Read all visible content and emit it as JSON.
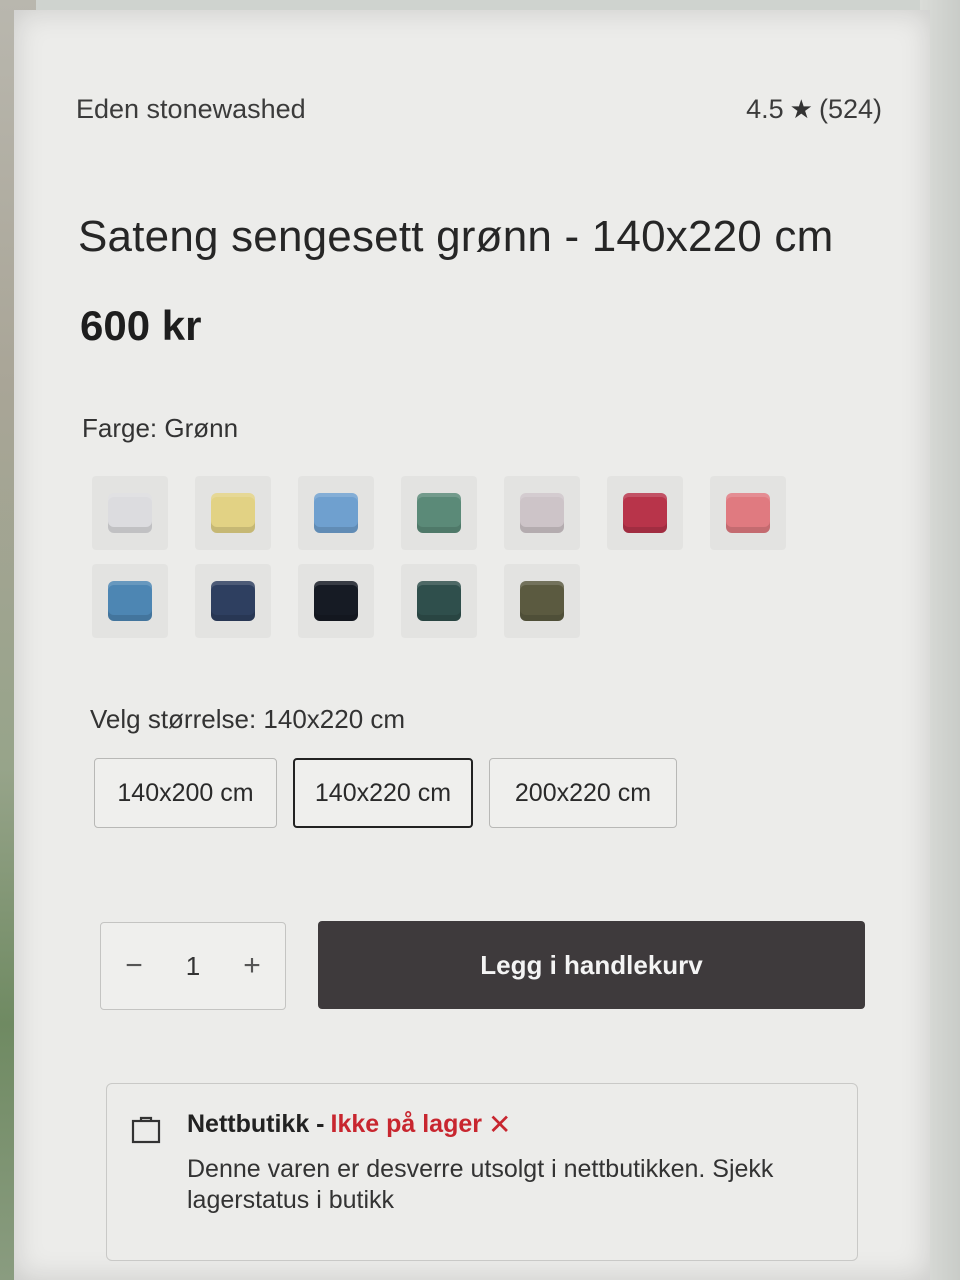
{
  "product": {
    "brand": "Eden stonewashed",
    "rating": "4.5",
    "rating_star": "★",
    "review_count": "(524)",
    "title": "Sateng sengesett grønn - 140x220 cm",
    "price": "600 kr"
  },
  "color": {
    "label": "Farge: Grønn",
    "swatches": [
      {
        "name": "white",
        "hex": "#dcdcdf"
      },
      {
        "name": "yellow",
        "hex": "#e2d284"
      },
      {
        "name": "light-blue",
        "hex": "#6fa0cf"
      },
      {
        "name": "green",
        "hex": "#5b8a78"
      },
      {
        "name": "light-grey",
        "hex": "#cdc4c8"
      },
      {
        "name": "red",
        "hex": "#b8344a"
      },
      {
        "name": "pink",
        "hex": "#e07a80"
      },
      {
        "name": "blue",
        "hex": "#4d86b3"
      },
      {
        "name": "navy",
        "hex": "#2e3f60"
      },
      {
        "name": "black",
        "hex": "#161b24"
      },
      {
        "name": "dark-green",
        "hex": "#2f4f4c"
      },
      {
        "name": "olive",
        "hex": "#5b5a40"
      }
    ]
  },
  "size": {
    "label": "Velg størrelse: 140x220 cm",
    "options": [
      "140x200 cm",
      "140x220 cm",
      "200x220 cm"
    ],
    "selected": "140x220 cm"
  },
  "cart": {
    "minus": "−",
    "quantity": "1",
    "plus": "+",
    "add_label": "Legg i handlekurv"
  },
  "stock": {
    "channel": "Nettbutikk -",
    "status": "Ikke på lager",
    "status_icon": "✕",
    "message": "Denne varen er desverre utsolgt i nettbutikken. Sjekk lagerstatus i butikk",
    "status_color": "#c8262f"
  }
}
